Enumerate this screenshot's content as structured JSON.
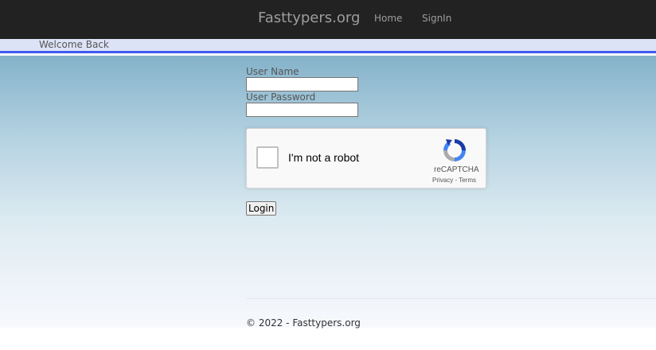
{
  "navbar": {
    "brand": "Fasttypers.org",
    "links": [
      {
        "label": "Home"
      },
      {
        "label": "SignIn"
      }
    ]
  },
  "welcome": {
    "text": "Welcome Back"
  },
  "form": {
    "username_label": "User Name",
    "username_value": "",
    "password_label": "User Password",
    "password_value": "",
    "login_label": "Login"
  },
  "captcha": {
    "checkbox_label": "I'm not a robot",
    "brand": "reCAPTCHA",
    "privacy": "Privacy",
    "separator": " - ",
    "terms": "Terms"
  },
  "footer": {
    "text": "© 2022 - Fasttypers.org"
  },
  "colors": {
    "navbar_bg": "#222222",
    "nav_text": "#9d9d9d",
    "welcome_bar": "#dde3f6",
    "accent_line": "#3e5bf2"
  }
}
